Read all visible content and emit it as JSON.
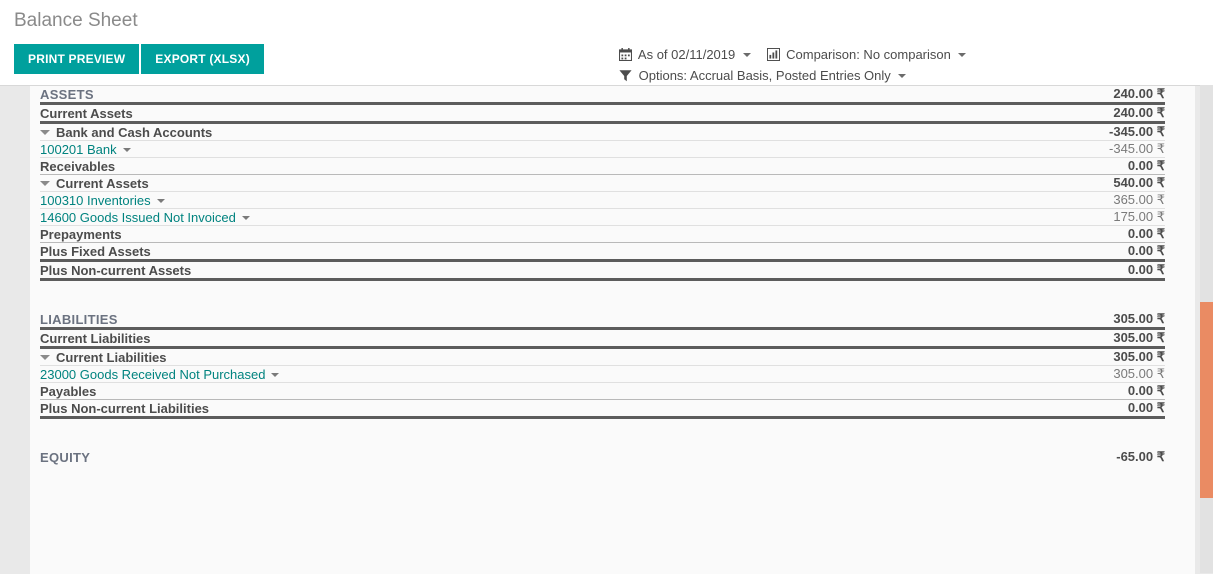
{
  "header": {
    "title": "Balance Sheet",
    "buttons": [
      {
        "label": "PRINT PREVIEW",
        "name": "print-preview-button"
      },
      {
        "label": "EXPORT (XLSX)",
        "name": "export-xlsx-button"
      }
    ]
  },
  "filters": {
    "date": {
      "icon": "calendar-icon",
      "label": "As of 02/11/2019"
    },
    "comparison": {
      "icon": "bar-chart-icon",
      "label": "Comparison: No comparison"
    },
    "options": {
      "icon": "filter-icon",
      "label": "Options: Accrual Basis, Posted Entries Only"
    }
  },
  "colors": {
    "accent": "#00a09d",
    "link": "#00837f",
    "scrollbar_thumb": "#ea8b63",
    "title": "#8a8a8a"
  },
  "report": {
    "currency_symbol": "₹",
    "rows": [
      {
        "label": "ASSETS",
        "value": "240.00 ₹",
        "style": "title",
        "indent": 0,
        "border": "thick",
        "toggle": false,
        "link": false,
        "bold_value": true
      },
      {
        "label": "Current Assets",
        "value": "240.00 ₹",
        "style": "bold",
        "indent": 1,
        "border": "thick",
        "toggle": false,
        "link": false,
        "bold_value": true
      },
      {
        "label": "Bank and Cash Accounts",
        "value": "-345.00 ₹",
        "style": "bold",
        "indent": 2,
        "border": "thin",
        "toggle": true,
        "link": false,
        "bold_value": true
      },
      {
        "label": "100201 Bank",
        "value": "-345.00 ₹",
        "style": "account",
        "indent": 3,
        "border": "thin",
        "toggle": false,
        "link": true,
        "bold_value": false
      },
      {
        "label": "Receivables",
        "value": "0.00 ₹",
        "style": "bold",
        "indent": 4,
        "border": "med",
        "toggle": false,
        "link": false,
        "bold_value": true
      },
      {
        "label": "Current Assets",
        "value": "540.00 ₹",
        "style": "bold",
        "indent": 2,
        "border": "thin",
        "toggle": true,
        "link": false,
        "bold_value": true
      },
      {
        "label": "100310 Inventories",
        "value": "365.00 ₹",
        "style": "account",
        "indent": 3,
        "border": "thin",
        "toggle": false,
        "link": true,
        "bold_value": false
      },
      {
        "label": "14600 Goods Issued Not Invoiced",
        "value": "175.00 ₹",
        "style": "account",
        "indent": 3,
        "border": "thin",
        "toggle": false,
        "link": true,
        "bold_value": false
      },
      {
        "label": "Prepayments",
        "value": "0.00 ₹",
        "style": "bold",
        "indent": 4,
        "border": "med",
        "toggle": false,
        "link": false,
        "bold_value": true
      },
      {
        "label": "Plus Fixed Assets",
        "value": "0.00 ₹",
        "style": "bold",
        "indent": 1,
        "border": "thick",
        "toggle": false,
        "link": false,
        "bold_value": true
      },
      {
        "label": "Plus Non-current Assets",
        "value": "0.00 ₹",
        "style": "bold",
        "indent": 1,
        "border": "thick",
        "toggle": false,
        "link": false,
        "bold_value": true
      },
      {
        "label": "",
        "value": "",
        "style": "spacer",
        "indent": 0,
        "border": "none",
        "toggle": false,
        "link": false,
        "bold_value": false
      },
      {
        "label": "LIABILITIES",
        "value": "305.00 ₹",
        "style": "title",
        "indent": 0,
        "border": "thick",
        "toggle": false,
        "link": false,
        "bold_value": true
      },
      {
        "label": "Current Liabilities",
        "value": "305.00 ₹",
        "style": "bold",
        "indent": 1,
        "border": "thick",
        "toggle": false,
        "link": false,
        "bold_value": true
      },
      {
        "label": "Current Liabilities",
        "value": "305.00 ₹",
        "style": "bold",
        "indent": 2,
        "border": "thin",
        "toggle": true,
        "link": false,
        "bold_value": true
      },
      {
        "label": "23000 Goods Received Not Purchased",
        "value": "305.00 ₹",
        "style": "account",
        "indent": 3,
        "border": "thin",
        "toggle": false,
        "link": true,
        "bold_value": false
      },
      {
        "label": "Payables",
        "value": "0.00 ₹",
        "style": "bold",
        "indent": 4,
        "border": "med",
        "toggle": false,
        "link": false,
        "bold_value": true
      },
      {
        "label": "Plus Non-current Liabilities",
        "value": "0.00 ₹",
        "style": "bold",
        "indent": 1,
        "border": "thick",
        "toggle": false,
        "link": false,
        "bold_value": true
      },
      {
        "label": "",
        "value": "",
        "style": "spacer",
        "indent": 0,
        "border": "none",
        "toggle": false,
        "link": false,
        "bold_value": false
      },
      {
        "label": "EQUITY",
        "value": "-65.00 ₹",
        "style": "title",
        "indent": 0,
        "border": "none",
        "toggle": false,
        "link": false,
        "bold_value": true
      }
    ]
  }
}
